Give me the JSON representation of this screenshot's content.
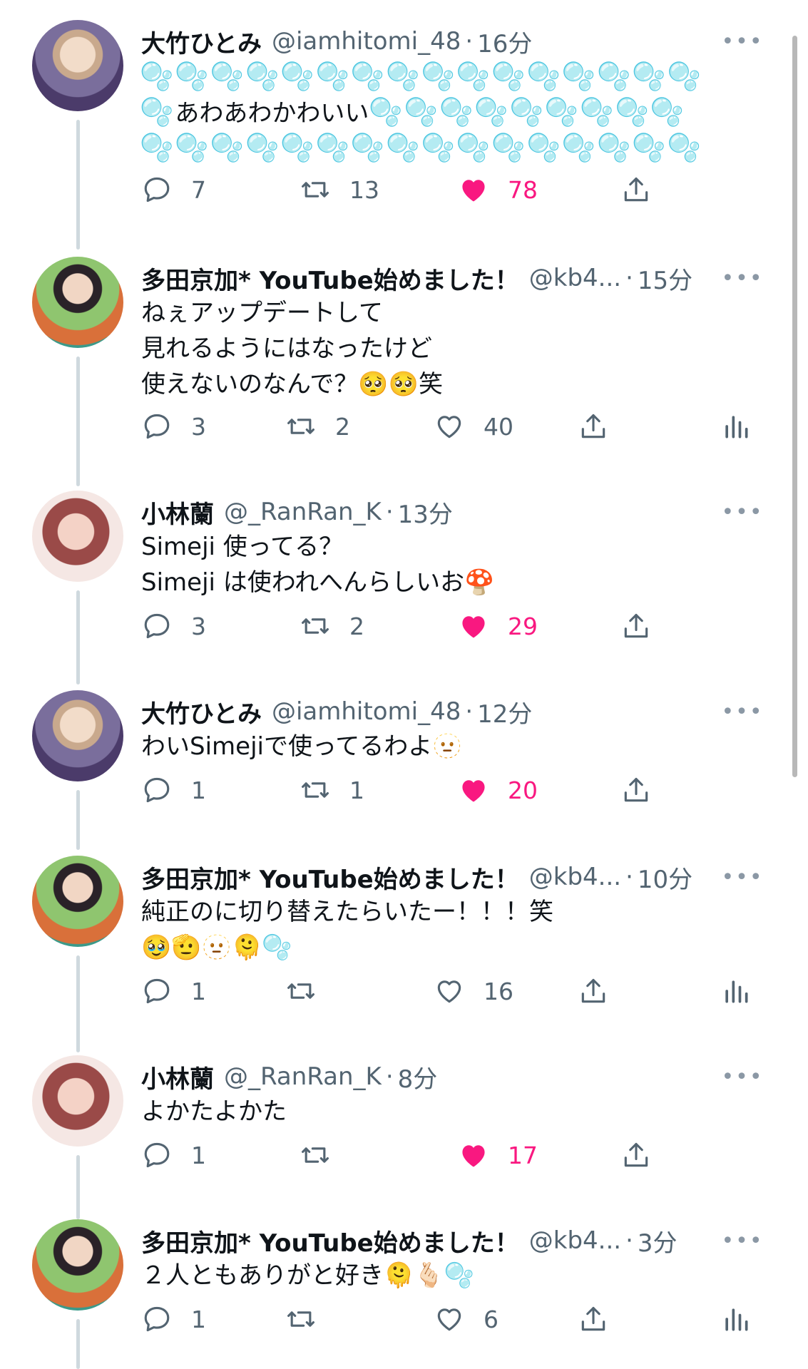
{
  "tweets": [
    {
      "name": "大竹ひとみ",
      "handle": "@iamhitomi_48",
      "time": "16分",
      "line1": "🫧🫧🫧🫧🫧🫧🫧🫧🫧🫧🫧🫧🫧🫧🫧🫧",
      "line2_text": "あわあわかわいい",
      "line2_bubbles": "🫧🫧🫧🫧🫧🫧🫧🫧🫧",
      "line2_lead": "🫧",
      "line3": "🫧🫧🫧🫧🫧🫧🫧🫧🫧🫧🫧🫧🫧🫧🫧🫧",
      "reply": "7",
      "retweet": "13",
      "like": "78",
      "liked": true
    },
    {
      "name": "多田京加* YouTube始めました！",
      "handle": "@kb4...",
      "time": "15分",
      "text": "ねぇアップデートして\n見れるようにはなったけど\n使えないのなんで？🥺🥺笑",
      "reply": "3",
      "retweet": "2",
      "like": "40",
      "liked": false
    },
    {
      "name": "小林蘭",
      "handle": "@_RanRan_K",
      "time": "13分",
      "text": "Simeji 使ってる？\nSimeji は使われへんらしいお🍄",
      "reply": "3",
      "retweet": "2",
      "like": "29",
      "liked": true
    },
    {
      "name": "大竹ひとみ",
      "handle": "@iamhitomi_48",
      "time": "12分",
      "text": "わいSimejiで使ってるわよ🫥",
      "reply": "1",
      "retweet": "1",
      "like": "20",
      "liked": true
    },
    {
      "name": "多田京加* YouTube始めました！",
      "handle": "@kb4...",
      "time": "10分",
      "text": "純正のに切り替えたらいたー！！！笑\n🥹🫡🫥🫠🫧",
      "reply": "1",
      "retweet": "",
      "like": "16",
      "liked": false
    },
    {
      "name": "小林蘭",
      "handle": "@_RanRan_K",
      "time": "8分",
      "text": "よかたよかた",
      "reply": "1",
      "retweet": "",
      "like": "17",
      "liked": true
    },
    {
      "name": "多田京加* YouTube始めました！",
      "handle": "@kb4...",
      "time": "3分",
      "text": "２人ともありがと好き🫠🫰🏻🫧",
      "reply": "1",
      "retweet": "",
      "like": "6",
      "liked": false
    }
  ],
  "icons": {
    "reply": "reply-icon",
    "retweet": "retweet-icon",
    "like": "heart-icon",
    "share": "share-icon",
    "analytics": "analytics-icon",
    "more": "more-icon"
  },
  "colors": {
    "like_active": "#f91880",
    "muted": "#536471",
    "thread_line": "#cfd9de"
  }
}
